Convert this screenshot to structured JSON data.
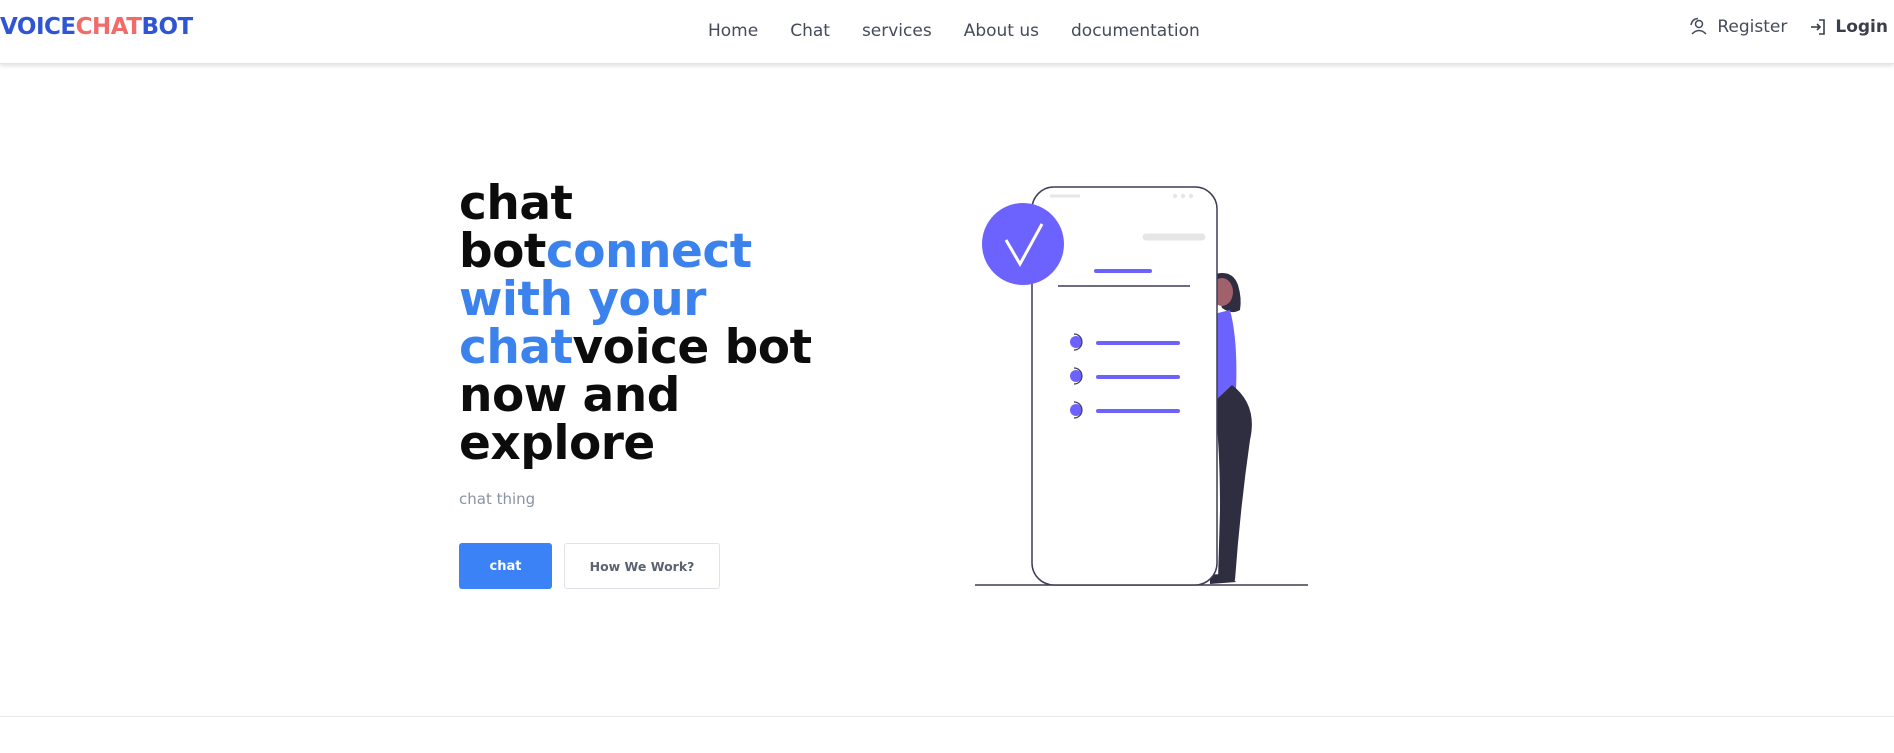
{
  "header": {
    "logo": {
      "voice": "VOICE",
      "chat": "CHAT",
      "bot": "BOT"
    },
    "nav": [
      {
        "label": "Home"
      },
      {
        "label": "Chat"
      },
      {
        "label": "services"
      },
      {
        "label": "About us"
      },
      {
        "label": "documentation"
      }
    ],
    "auth": {
      "register": "Register",
      "login": "Login"
    }
  },
  "hero": {
    "title_parts": {
      "p1": "chat",
      "p2": "bot",
      "p3": "connect",
      "p4": "with your",
      "p5": "chat",
      "p6": "voice bot",
      "p7": "now and",
      "p8": "explore"
    },
    "subtitle": "chat thing",
    "primary_button": "chat",
    "secondary_button": "How We Work?"
  },
  "colors": {
    "accent_blue": "#3b82f6",
    "logo_blue": "#2f55d4",
    "logo_red": "#f26b6b",
    "illustration_purple": "#6c63ff"
  }
}
